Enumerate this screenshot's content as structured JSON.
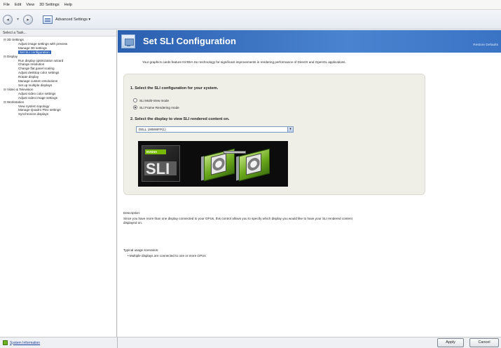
{
  "menu": [
    "File",
    "Edit",
    "View",
    "3D Settings",
    "Help"
  ],
  "toolbar": {
    "back_label": "Back",
    "advanced_label": "Advanced Settings"
  },
  "left": {
    "header": "Select a Task...",
    "tree": [
      {
        "label": "3D Settings",
        "level": 0
      },
      {
        "label": "Adjust image settings with preview",
        "level": 1
      },
      {
        "label": "Manage 3D settings",
        "level": 1
      },
      {
        "label": "Set SLI configuration",
        "level": 1,
        "selected": true
      },
      {
        "label": "Display",
        "level": 0
      },
      {
        "label": "Run display optimization wizard",
        "level": 1
      },
      {
        "label": "Change resolution",
        "level": 1
      },
      {
        "label": "Change flat panel scaling",
        "level": 1
      },
      {
        "label": "Adjust desktop color settings",
        "level": 1
      },
      {
        "label": "Rotate display",
        "level": 1
      },
      {
        "label": "Manage custom resolutions",
        "level": 1
      },
      {
        "label": "Set up multiple displays",
        "level": 1
      },
      {
        "label": "Video & Television",
        "level": 0
      },
      {
        "label": "Adjust video color settings",
        "level": 1
      },
      {
        "label": "Adjust video image settings",
        "level": 1
      },
      {
        "label": "Workstation",
        "level": 0
      },
      {
        "label": "View system topology",
        "level": 1
      },
      {
        "label": "Manage Quadro Plex settings",
        "level": 1
      },
      {
        "label": "Synchronize displays",
        "level": 1
      }
    ],
    "system_info": "System Information"
  },
  "main": {
    "title": "Set SLI Configuration",
    "restore": "Restore Defaults",
    "intro": "Your graphics cards feature NVIDIA SLI technology for significant improvements in rendering performance of DirectX and OpenGL applications.",
    "step1": "1. Select the SLI configuration for your system.",
    "options": [
      {
        "label": "SLI Multi-View mode",
        "selected": false
      },
      {
        "label": "SLI Frame Rendering mode",
        "selected": true
      }
    ],
    "step2": "2. Select the display to view SLI rendered content on.",
    "display_select": "DELL 1908WFP(1)",
    "image": {
      "brand": "NVIDIA",
      "logo": "SLI"
    },
    "description_label": "Description:",
    "description": "Since you have more than one display connected to your GPUs, this control allows you to specify which display you would like to have your SLI rendered content displayed on.",
    "usage_label": "Typical usage scenarios:",
    "usage_items": [
      "Multiple displays are connected to one or more GPUs"
    ]
  },
  "buttons": {
    "apply": "Apply",
    "cancel": "Cancel"
  },
  "colors": {
    "banner": "#2b5fb0",
    "selection": "#2d63b8",
    "nvidia_green": "#76b900"
  }
}
